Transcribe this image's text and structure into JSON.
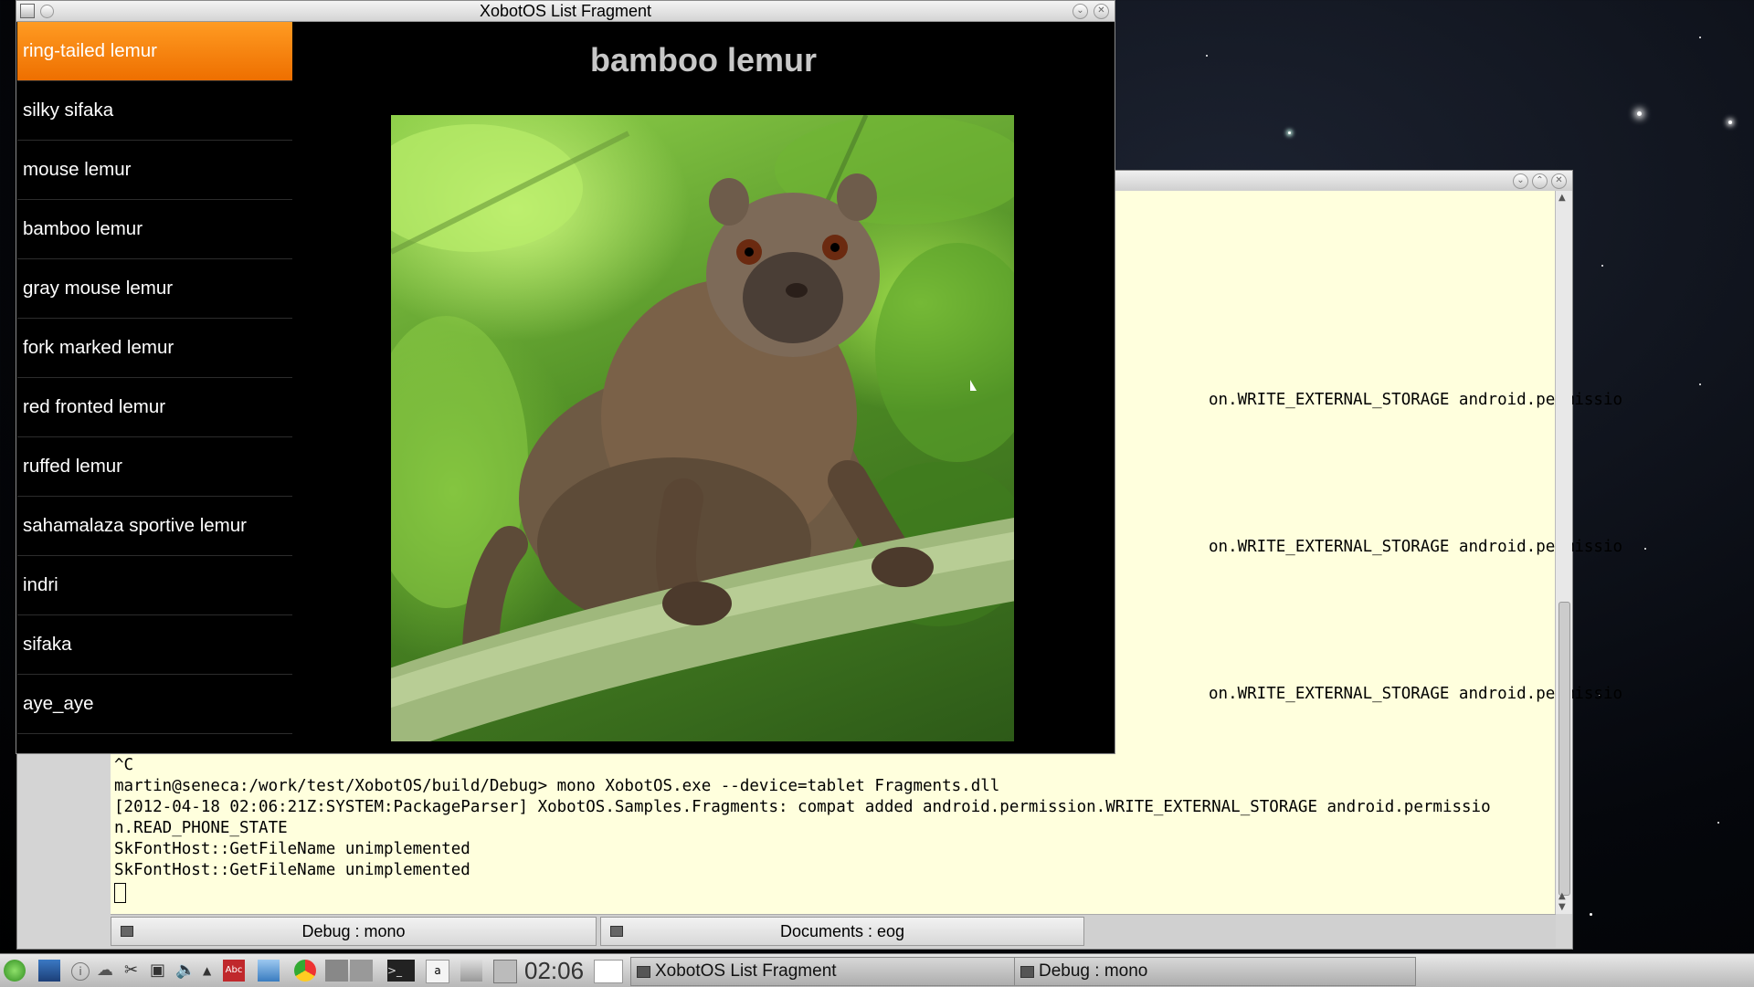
{
  "app_window": {
    "title": "XobotOS List Fragment",
    "list_items": [
      "ring-tailed lemur",
      "silky sifaka",
      "mouse lemur",
      "bamboo lemur",
      "gray mouse lemur",
      "fork marked lemur",
      "red fronted lemur",
      "ruffed lemur",
      "sahamalaza sportive lemur",
      "indri",
      "sifaka",
      "aye_aye"
    ],
    "selected_index": 0,
    "detail_title": "bamboo lemur",
    "photo_subject": "bamboo lemur"
  },
  "terminal": {
    "partial_lines": [
      "on.WRITE_EXTERNAL_STORAGE android.permissio",
      "on.WRITE_EXTERNAL_STORAGE android.permissio",
      "on.WRITE_EXTERNAL_STORAGE android.permissio"
    ],
    "lines": [
      "^C",
      "martin@seneca:/work/test/XobotOS/build/Debug> mono XobotOS.exe --device=tablet Fragments.dll",
      "[2012-04-18 02:06:21Z:SYSTEM:PackageParser] XobotOS.Samples.Fragments: compat added android.permission.WRITE_EXTERNAL_STORAGE android.permissio",
      "n.READ_PHONE_STATE",
      "SkFontHost::GetFileName unimplemented",
      "SkFontHost::GetFileName unimplemented"
    ],
    "tabs": [
      "Debug : mono",
      "Documents : eog"
    ],
    "background_color": "#ffffdd"
  },
  "taskbar": {
    "clock": "02:06",
    "tasks": [
      "XobotOS List Fragment",
      "Debug : mono"
    ],
    "icons": [
      "start-menu-icon",
      "desktop-icon",
      "info-icon",
      "network-icon",
      "scissors-icon",
      "clipboard-icon",
      "volume-icon",
      "tray-arrow-icon",
      "dictionary-icon",
      "file-manager-icon",
      "chrome-icon",
      "workspace-switcher-icon",
      "terminal-icon",
      "text-editor-icon",
      "archive-icon",
      "calculator-icon",
      "show-desktop-icon"
    ]
  },
  "colors": {
    "selected_item": "#f07a00",
    "detail_title": "#c8c8c8"
  }
}
